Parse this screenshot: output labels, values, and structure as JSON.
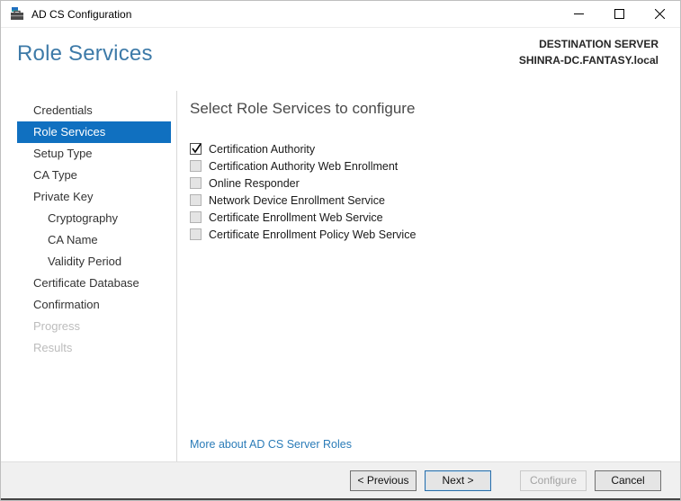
{
  "window": {
    "title": "AD CS Configuration"
  },
  "header": {
    "page_title": "Role Services",
    "destination_label": "DESTINATION SERVER",
    "destination_server": "SHINRA-DC.FANTASY.local"
  },
  "sidebar": {
    "items": [
      {
        "label": "Credentials",
        "state": ""
      },
      {
        "label": "Role Services",
        "state": "active"
      },
      {
        "label": "Setup Type",
        "state": ""
      },
      {
        "label": "CA Type",
        "state": ""
      },
      {
        "label": "Private Key",
        "state": ""
      },
      {
        "label": "Cryptography",
        "state": "indent"
      },
      {
        "label": "CA Name",
        "state": "indent"
      },
      {
        "label": "Validity Period",
        "state": "indent"
      },
      {
        "label": "Certificate Database",
        "state": ""
      },
      {
        "label": "Confirmation",
        "state": ""
      },
      {
        "label": "Progress",
        "state": "disabled"
      },
      {
        "label": "Results",
        "state": "disabled"
      }
    ]
  },
  "main": {
    "section_title": "Select Role Services to configure",
    "role_services": [
      {
        "label": "Certification Authority",
        "state": "checked"
      },
      {
        "label": "Certification Authority Web Enrollment",
        "state": ""
      },
      {
        "label": "Online Responder",
        "state": ""
      },
      {
        "label": "Network Device Enrollment Service",
        "state": ""
      },
      {
        "label": "Certificate Enrollment Web Service",
        "state": ""
      },
      {
        "label": "Certificate Enrollment Policy Web Service",
        "state": ""
      }
    ],
    "more_link": "More about AD CS Server Roles"
  },
  "footer": {
    "buttons": [
      {
        "label": "< Previous",
        "state": ""
      },
      {
        "label": "Next >",
        "state": "default"
      },
      {
        "label": "Configure",
        "state": "disabled gap-left"
      },
      {
        "label": "Cancel",
        "state": ""
      }
    ]
  },
  "colors": {
    "accent_selected": "#1070c0",
    "heading_blue": "#3d7aa8",
    "link_blue": "#2b7cb8",
    "footer_gray": "#f0f0f0"
  }
}
